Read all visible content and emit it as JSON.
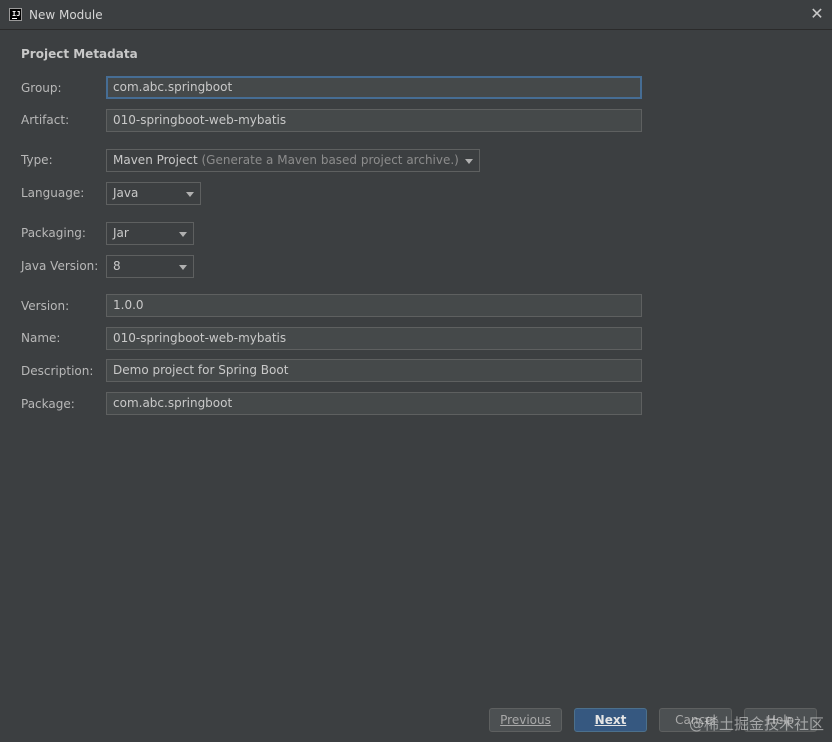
{
  "window": {
    "title": "New Module",
    "icon": "intellij-app-icon",
    "icon_text": "IJ",
    "close_glyph": "✕"
  },
  "section": {
    "title": "Project Metadata"
  },
  "form": {
    "group": {
      "label": "Group:",
      "value": "com.abc.springboot"
    },
    "artifact": {
      "label": "Artifact:",
      "value": "010-springboot-web-mybatis"
    },
    "type": {
      "label": "Type:",
      "value": "Maven Project",
      "hint": "(Generate a Maven based project archive.)"
    },
    "language": {
      "label": "Language:",
      "value": "Java"
    },
    "packaging": {
      "label": "Packaging:",
      "value": "Jar"
    },
    "java_version": {
      "label": "Java Version:",
      "value": "8"
    },
    "version": {
      "label": "Version:",
      "value": "1.0.0"
    },
    "name": {
      "label": "Name:",
      "value": "010-springboot-web-mybatis"
    },
    "description": {
      "label": "Description:",
      "value": "Demo project for Spring Boot"
    },
    "package": {
      "label": "Package:",
      "value": "com.abc.springboot"
    }
  },
  "buttons": {
    "previous": "Previous",
    "next": "Next",
    "cancel": "Cancel",
    "help": "Help"
  },
  "watermark": "@稀土掘金技术社区",
  "colors": {
    "background": "#3c3f41",
    "field_background": "#45494a",
    "focus_border": "#466d94",
    "primary_button": "#365880"
  }
}
